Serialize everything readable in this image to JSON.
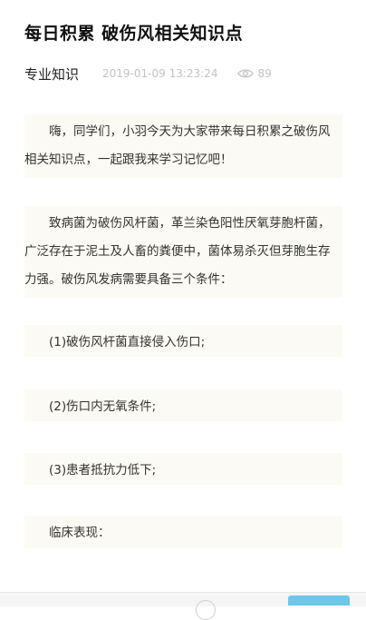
{
  "article": {
    "title": "每日积累 破伤风相关知识点",
    "category": "专业知识",
    "timestamp": "2019-01-09 13:23:24",
    "views": "89",
    "views_icon": "eye-icon",
    "paragraphs": [
      "嗨，同学们，小羽今天为大家带来每日积累之破伤风相关知识点，一起跟我来学习记忆吧！",
      "致病菌为破伤风杆菌，革兰染色阳性厌氧芽胞杆菌，广泛存在于泥土及人畜的粪便中，菌体易杀灭但芽胞生存力强。破伤风发病需要具备三个条件：",
      "(1)破伤风杆菌直接侵入伤口;",
      "(2)伤口内无氧条件;",
      "(3)患者抵抗力低下;",
      "临床表现："
    ]
  },
  "colors": {
    "block_background": "#fbfaf4",
    "meta_text": "#c2c2c2",
    "accent_button": "#6ec7e8"
  }
}
